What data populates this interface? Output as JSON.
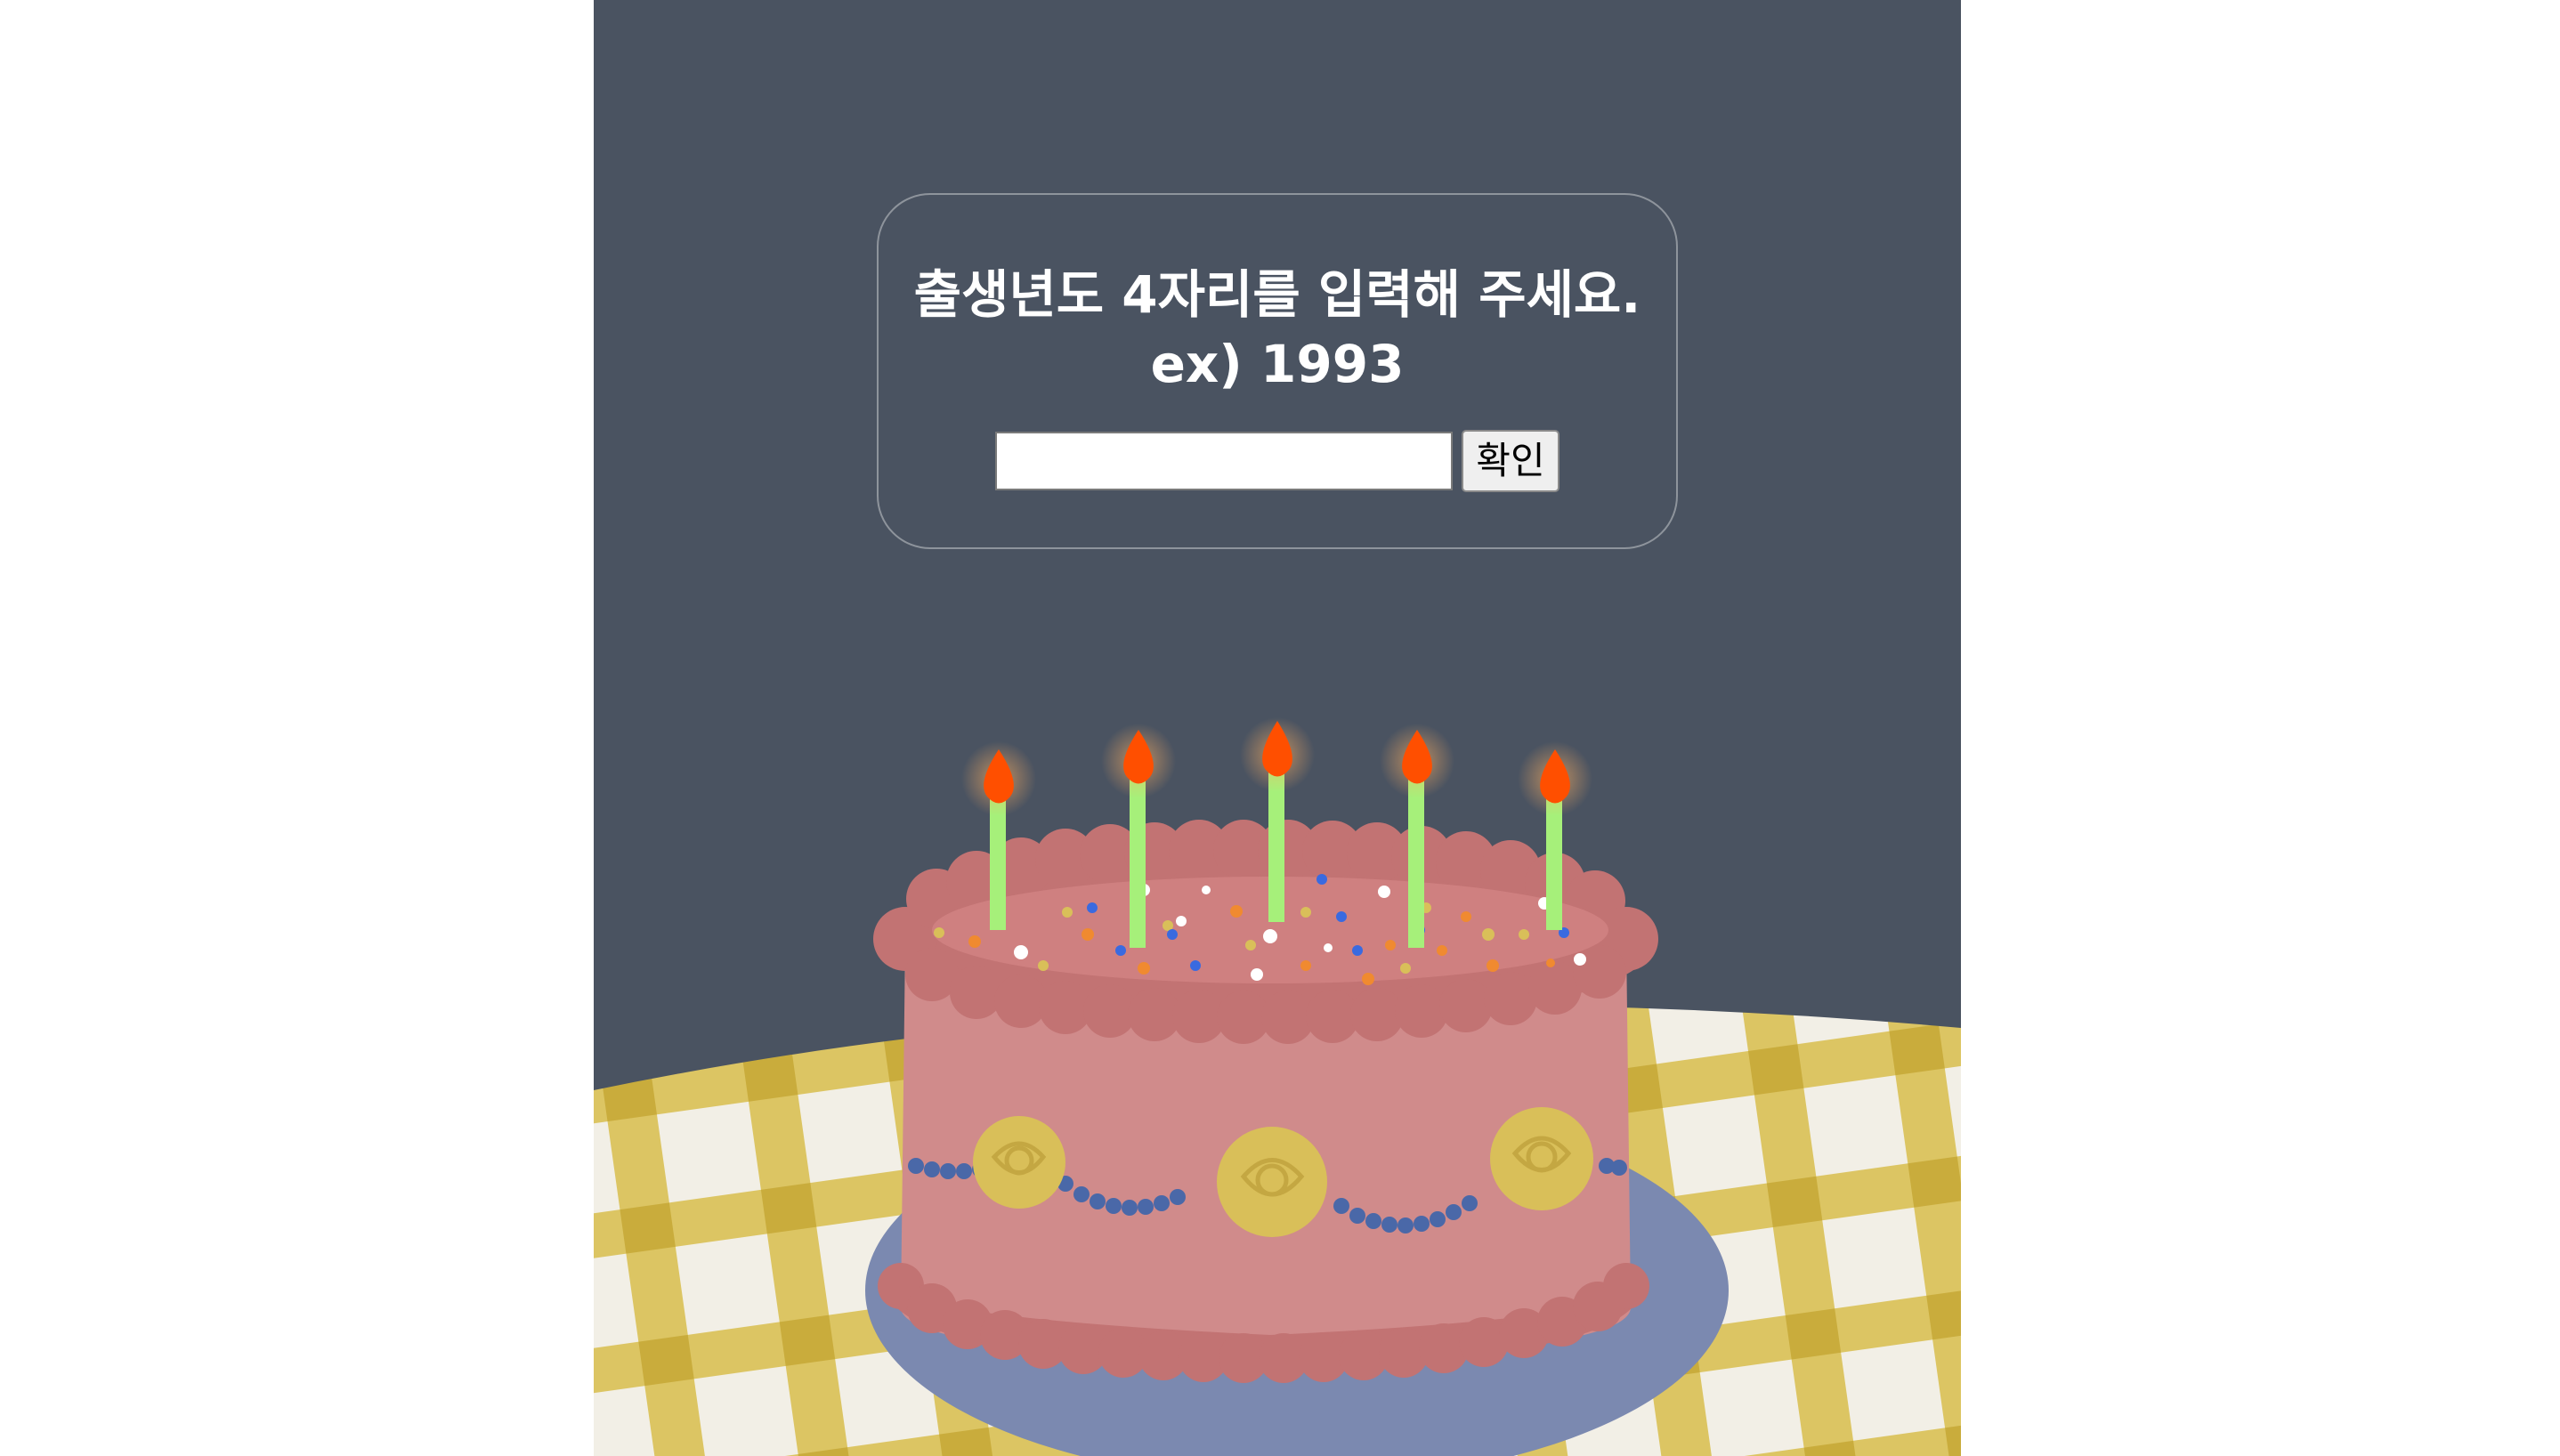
{
  "prompt": {
    "line1": "출생년도 4자리를 입력해 주세요.",
    "line2": "ex) 1993"
  },
  "form": {
    "input_value": "",
    "input_placeholder": "",
    "confirm_label": "확인"
  },
  "illustration": {
    "candle_count": 5
  },
  "colors": {
    "background": "#4a5361",
    "tablecloth": "#d8bd4c",
    "plate": "#7b89b0",
    "cake": "#d08b8b",
    "frosting": "#c27373",
    "candle": "#a6f07a",
    "flame": "#ff4f00",
    "roses": "#d9bf59",
    "beads": "#4a68a8"
  }
}
